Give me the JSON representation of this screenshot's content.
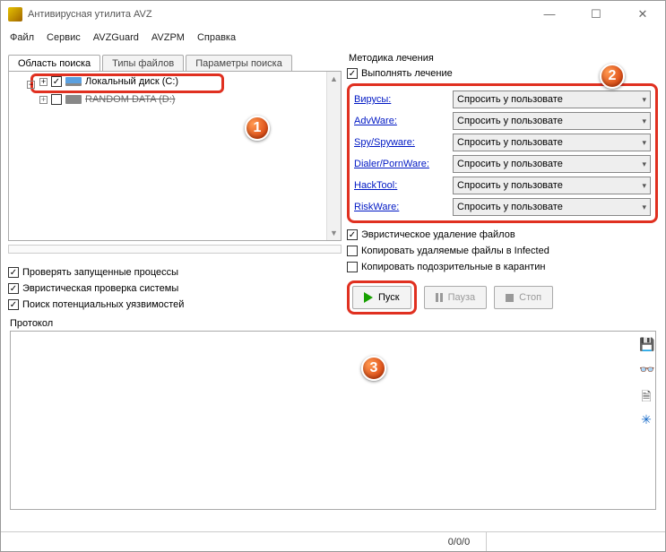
{
  "window": {
    "title": "Антивирусная утилита AVZ"
  },
  "menu": [
    "Файл",
    "Сервис",
    "AVZGuard",
    "AVZPM",
    "Справка"
  ],
  "left": {
    "tabs": [
      "Область поиска",
      "Типы файлов",
      "Параметры поиска"
    ],
    "drives": [
      {
        "label": "Локальный диск (C:)",
        "checked": true
      },
      {
        "label": "RANDOM DATA (D:)",
        "checked": false
      }
    ],
    "checks": [
      "Проверять запущенные процессы",
      "Эвристическая проверка системы",
      "Поиск потенциальных уязвимостей"
    ]
  },
  "right": {
    "group": "Методика лечения",
    "enable": "Выполнять лечение",
    "rows": [
      {
        "name": "Вирусы:",
        "value": "Спросить у пользовате"
      },
      {
        "name": "AdvWare:",
        "value": "Спросить у пользовате"
      },
      {
        "name": "Spy/Spyware:",
        "value": "Спросить у пользовате"
      },
      {
        "name": "Dialer/PornWare:",
        "value": "Спросить у пользовате"
      },
      {
        "name": "HackTool:",
        "value": "Спросить у пользовате"
      },
      {
        "name": "RiskWare:",
        "value": "Спросить у пользовате"
      }
    ],
    "extras": [
      "Эвристическое удаление файлов",
      "Копировать удаляемые файлы в  Infected",
      "Копировать подозрительные в  карантин"
    ],
    "buttons": {
      "start": "Пуск",
      "pause": "Пауза",
      "stop": "Стоп"
    }
  },
  "protocol": {
    "label": "Протокол"
  },
  "status": {
    "progress": "0/0/0"
  },
  "badges": [
    "1",
    "2",
    "3"
  ]
}
